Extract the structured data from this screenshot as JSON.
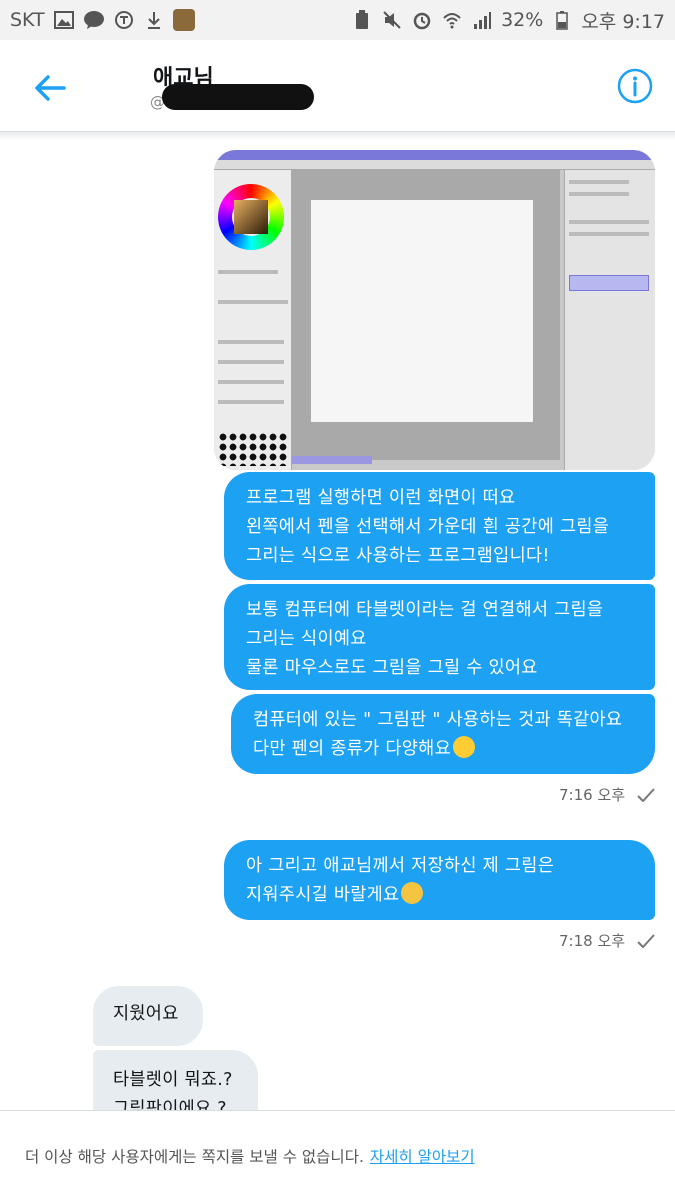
{
  "status_bar": {
    "carrier": "SKT",
    "battery": "32%",
    "time": "오후 9:17"
  },
  "header": {
    "name": "애교님",
    "handle_prefix": "@"
  },
  "messages": {
    "m1": [
      "프로그램 실행하면 이런 화면이 떠요",
      "왼쪽에서 펜을 선택해서 가운데 흰 공간에 그림을",
      "그리는 식으로 사용하는 프로그램입니다!"
    ],
    "m2": [
      "보통 컴퓨터에 타블렛이라는 걸 연결해서 그림을",
      "그리는 식이예요",
      "물론 마우스로도 그림을 그릴 수 있어요"
    ],
    "m3": [
      "컴퓨터에 있는 \" 그림판 \" 사용하는 것과 똑같아요",
      "다만 펜의 종류가 다양해요"
    ],
    "time1": "7:16 오후",
    "m4": [
      "아 그리고 애교님께서 저장하신 제 그림은",
      "지워주시길 바랄게요"
    ],
    "time2": "7:18 오후",
    "r1": "지웠어요",
    "r2": [
      "타블렛이 뭐죠.?",
      "그림판이에요.?"
    ]
  },
  "footer": {
    "notice": "더 이상 해당 사용자에게는 쪽지를 보낼 수 없습니다.",
    "link": "자세히 알아보기"
  },
  "colors": {
    "accent": "#1da1f2",
    "received_bubble": "#e6ecf0"
  }
}
